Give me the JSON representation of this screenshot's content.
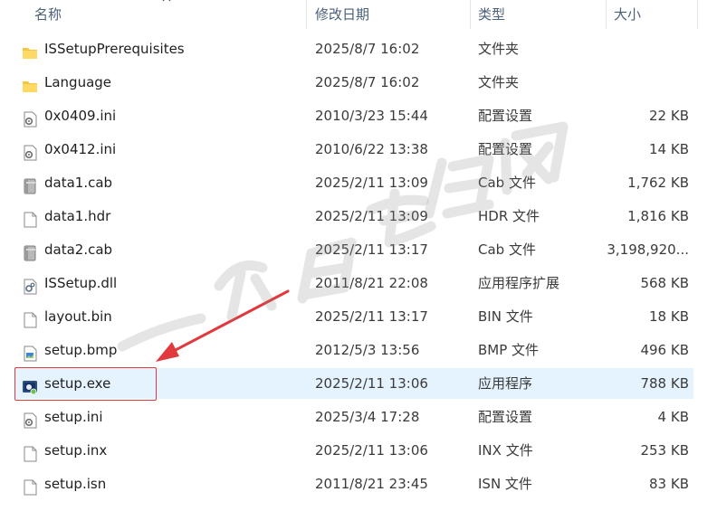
{
  "columns": {
    "name": "名称",
    "modified": "修改日期",
    "type": "类型",
    "size": "大小"
  },
  "files": [
    {
      "name": "ISSetupPrerequisites",
      "modified": "2025/8/7 16:02",
      "type": "文件夹",
      "size": "",
      "icon": "folder-icon"
    },
    {
      "name": "Language",
      "modified": "2025/8/7 16:02",
      "type": "文件夹",
      "size": "",
      "icon": "folder-icon"
    },
    {
      "name": "0x0409.ini",
      "modified": "2010/3/23 15:44",
      "type": "配置设置",
      "size": "22 KB",
      "icon": "ini-settings-icon"
    },
    {
      "name": "0x0412.ini",
      "modified": "2010/6/22 13:38",
      "type": "配置设置",
      "size": "14 KB",
      "icon": "ini-settings-icon"
    },
    {
      "name": "data1.cab",
      "modified": "2025/2/11 13:09",
      "type": "Cab 文件",
      "size": "1,762 KB",
      "icon": "cab-archive-icon"
    },
    {
      "name": "data1.hdr",
      "modified": "2025/2/11 13:09",
      "type": "HDR 文件",
      "size": "1,816 KB",
      "icon": "blank-file-icon"
    },
    {
      "name": "data2.cab",
      "modified": "2025/2/11 13:17",
      "type": "Cab 文件",
      "size": "3,198,920...",
      "icon": "cab-archive-icon"
    },
    {
      "name": "ISSetup.dll",
      "modified": "2011/8/21 22:08",
      "type": "应用程序扩展",
      "size": "568 KB",
      "icon": "dll-gear-icon"
    },
    {
      "name": "layout.bin",
      "modified": "2025/2/11 13:17",
      "type": "BIN 文件",
      "size": "18 KB",
      "icon": "blank-file-icon"
    },
    {
      "name": "setup.bmp",
      "modified": "2012/5/3 13:56",
      "type": "BMP 文件",
      "size": "496 KB",
      "icon": "bitmap-image-icon"
    },
    {
      "name": "setup.exe",
      "modified": "2025/2/11 13:06",
      "type": "应用程序",
      "size": "788 KB",
      "icon": "setup-exe-icon",
      "selected": true
    },
    {
      "name": "setup.ini",
      "modified": "2025/3/4 17:28",
      "type": "配置设置",
      "size": "4 KB",
      "icon": "ini-settings-icon"
    },
    {
      "name": "setup.inx",
      "modified": "2025/2/11 13:06",
      "type": "INX 文件",
      "size": "253 KB",
      "icon": "blank-file-icon"
    },
    {
      "name": "setup.isn",
      "modified": "2011/8/21 23:45",
      "type": "ISN 文件",
      "size": "83 KB",
      "icon": "blank-file-icon"
    }
  ],
  "annotation": {
    "arrow_color": "#e0393e"
  }
}
